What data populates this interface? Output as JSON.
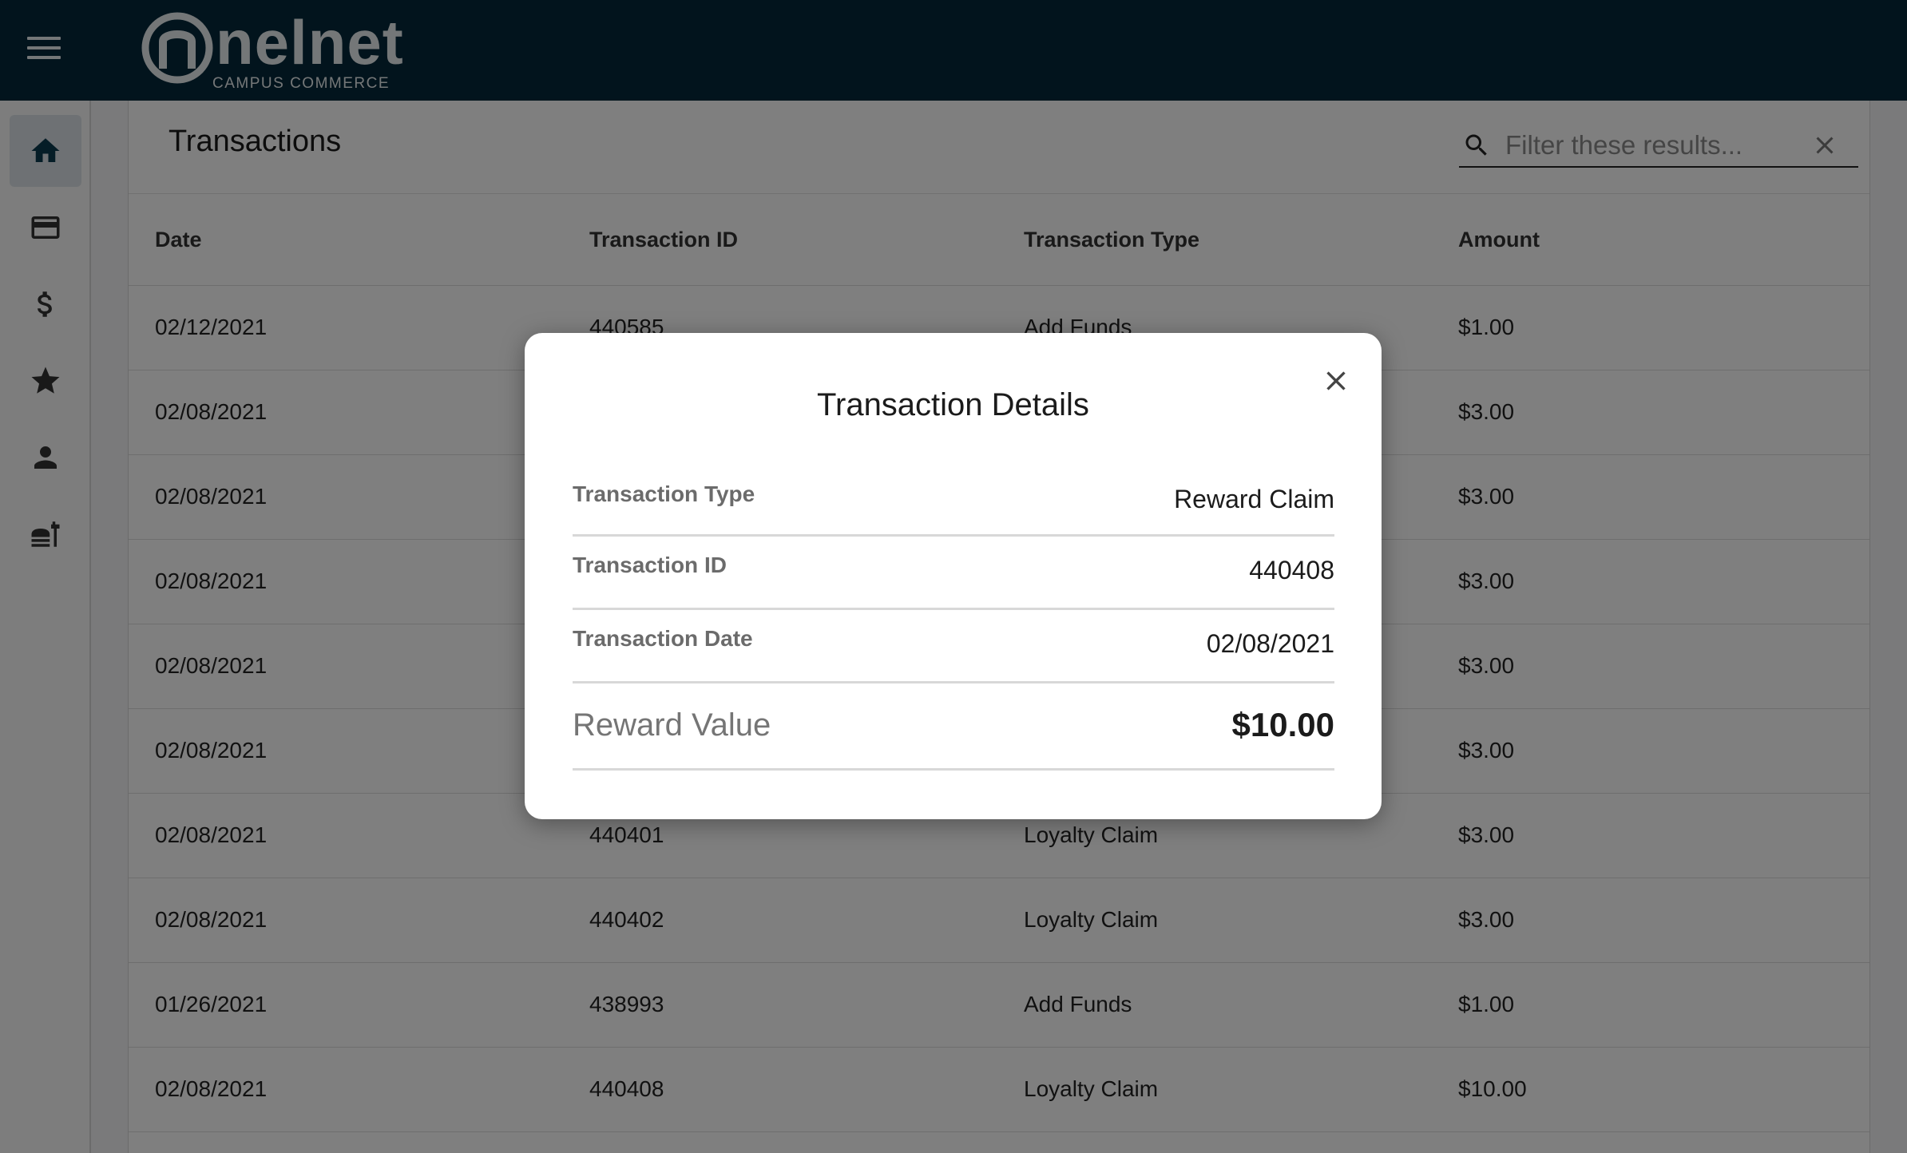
{
  "brand": {
    "name": "nelnet",
    "subtitle": "CAMPUS COMMERCE"
  },
  "sidebar": {
    "items": [
      {
        "icon": "home-icon",
        "active": true
      },
      {
        "icon": "credit-card-icon",
        "active": false
      },
      {
        "icon": "dollar-icon",
        "active": false
      },
      {
        "icon": "star-icon",
        "active": false
      },
      {
        "icon": "person-icon",
        "active": false
      },
      {
        "icon": "food-service-icon",
        "active": false
      }
    ]
  },
  "page": {
    "title": "Transactions",
    "filter_placeholder": "Filter these results..."
  },
  "table": {
    "headers": [
      "Date",
      "Transaction ID",
      "Transaction Type",
      "Amount"
    ],
    "rows": [
      [
        "02/12/2021",
        "440585",
        "Add Funds",
        "$1.00"
      ],
      [
        "02/08/2021",
        "",
        "",
        "$3.00"
      ],
      [
        "02/08/2021",
        "",
        "",
        "$3.00"
      ],
      [
        "02/08/2021",
        "",
        "",
        "$3.00"
      ],
      [
        "02/08/2021",
        "",
        "",
        "$3.00"
      ],
      [
        "02/08/2021",
        "",
        "",
        "$3.00"
      ],
      [
        "02/08/2021",
        "440401",
        "Loyalty Claim",
        "$3.00"
      ],
      [
        "02/08/2021",
        "440402",
        "Loyalty Claim",
        "$3.00"
      ],
      [
        "01/26/2021",
        "438993",
        "Add Funds",
        "$1.00"
      ],
      [
        "02/08/2021",
        "440408",
        "Loyalty Claim",
        "$10.00"
      ]
    ]
  },
  "dialog": {
    "title": "Transaction Details",
    "rows": [
      {
        "label": "Transaction Type",
        "value": "Reward Claim"
      },
      {
        "label": "Transaction ID",
        "value": "440408"
      },
      {
        "label": "Transaction Date",
        "value": "02/08/2021"
      },
      {
        "label": "Reward Value",
        "value": "$10.00"
      }
    ]
  },
  "colors": {
    "topbar": "#05293a",
    "accent": "#0b3a4f"
  }
}
